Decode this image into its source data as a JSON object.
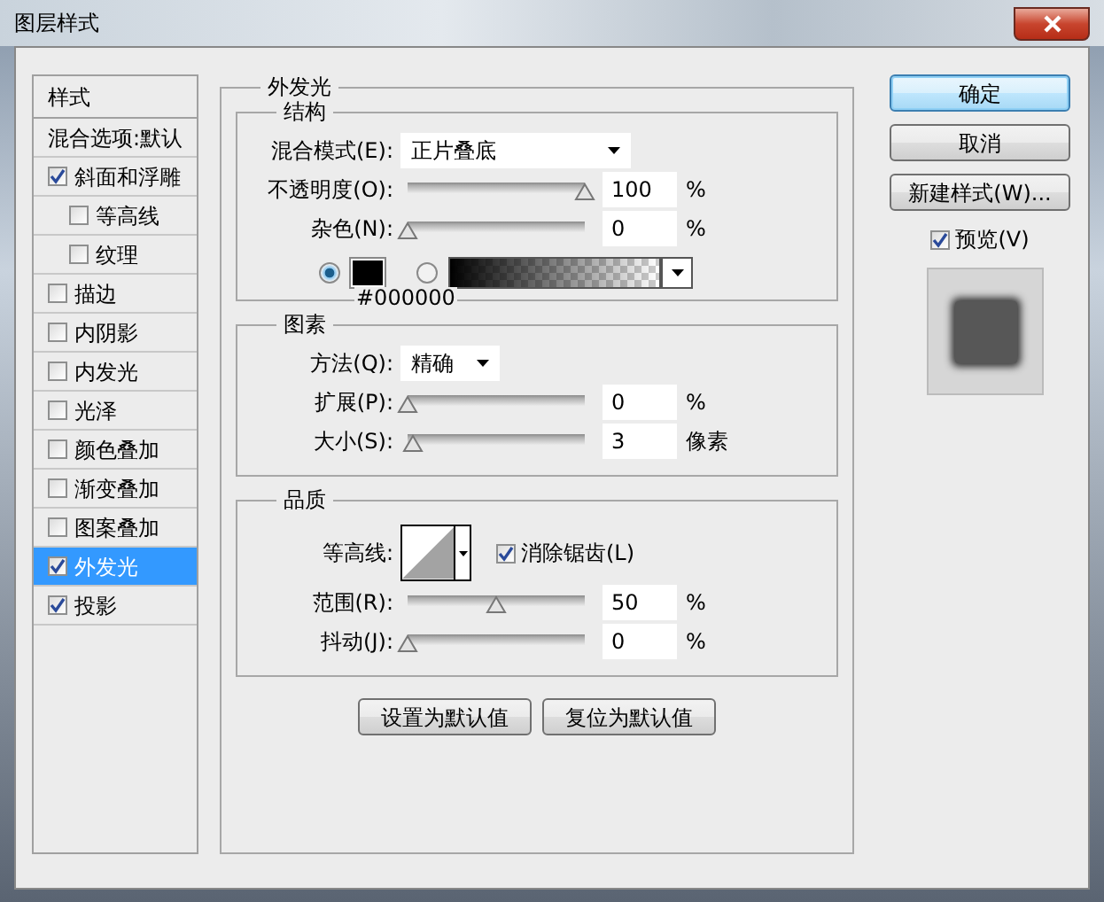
{
  "window": {
    "title": "图层样式"
  },
  "styles_list": {
    "header": "样式",
    "items": [
      {
        "label": "混合选项:默认",
        "kind": "plain",
        "selected": false
      },
      {
        "label": "斜面和浮雕",
        "kind": "check",
        "checked": true,
        "selected": false,
        "children": [
          {
            "label": "等高线",
            "kind": "check",
            "checked": false,
            "selected": false
          },
          {
            "label": "纹理",
            "kind": "check",
            "checked": false,
            "selected": false
          }
        ]
      },
      {
        "label": "描边",
        "kind": "check",
        "checked": false,
        "selected": false
      },
      {
        "label": "内阴影",
        "kind": "check",
        "checked": false,
        "selected": false
      },
      {
        "label": "内发光",
        "kind": "check",
        "checked": false,
        "selected": false
      },
      {
        "label": "光泽",
        "kind": "check",
        "checked": false,
        "selected": false
      },
      {
        "label": "颜色叠加",
        "kind": "check",
        "checked": false,
        "selected": false
      },
      {
        "label": "渐变叠加",
        "kind": "check",
        "checked": false,
        "selected": false
      },
      {
        "label": "图案叠加",
        "kind": "check",
        "checked": false,
        "selected": false
      },
      {
        "label": "外发光",
        "kind": "check",
        "checked": true,
        "selected": true
      },
      {
        "label": "投影",
        "kind": "check",
        "checked": true,
        "selected": false
      }
    ]
  },
  "outer_glow": {
    "legend": "外发光",
    "structure": {
      "legend": "结构",
      "blend_mode": {
        "label": "混合模式(E):",
        "value": "正片叠底"
      },
      "opacity": {
        "label": "不透明度(O):",
        "level": 1.0,
        "value": "100",
        "unit": "%"
      },
      "noise": {
        "label": "杂色(N):",
        "level": 0,
        "value": "0",
        "unit": "%"
      },
      "color_options": [
        {
          "kind": "swatch",
          "selected": true
        },
        {
          "kind": "gradient",
          "selected": false
        }
      ],
      "color_hex": "#000000"
    },
    "elements": {
      "legend": "图素",
      "technique": {
        "label": "方法(Q):",
        "value": "精确"
      },
      "spread": {
        "label": "扩展(P):",
        "level": 0,
        "value": "0",
        "unit": "%"
      },
      "size": {
        "label": "大小(S):",
        "level": 0.03,
        "value": "3",
        "unit": "像素"
      }
    },
    "quality": {
      "legend": "品质",
      "contour_label": "等高线:",
      "anti_alias": {
        "label": "消除锯齿(L)",
        "checked": true
      },
      "range": {
        "label": "范围(R):",
        "level": 0.5,
        "value": "50",
        "unit": "%"
      },
      "jitter": {
        "label": "抖动(J):",
        "level": 0,
        "value": "0",
        "unit": "%"
      }
    },
    "buttons": [
      "设置为默认值",
      "复位为默认值"
    ]
  },
  "actions": {
    "buttons": [
      {
        "label": "确定",
        "kind": "default"
      },
      {
        "label": "取消",
        "kind": "normal"
      },
      {
        "label": "新建样式(W)...",
        "kind": "normal"
      }
    ],
    "preview": {
      "label": "预览(V)",
      "checked": true
    }
  }
}
